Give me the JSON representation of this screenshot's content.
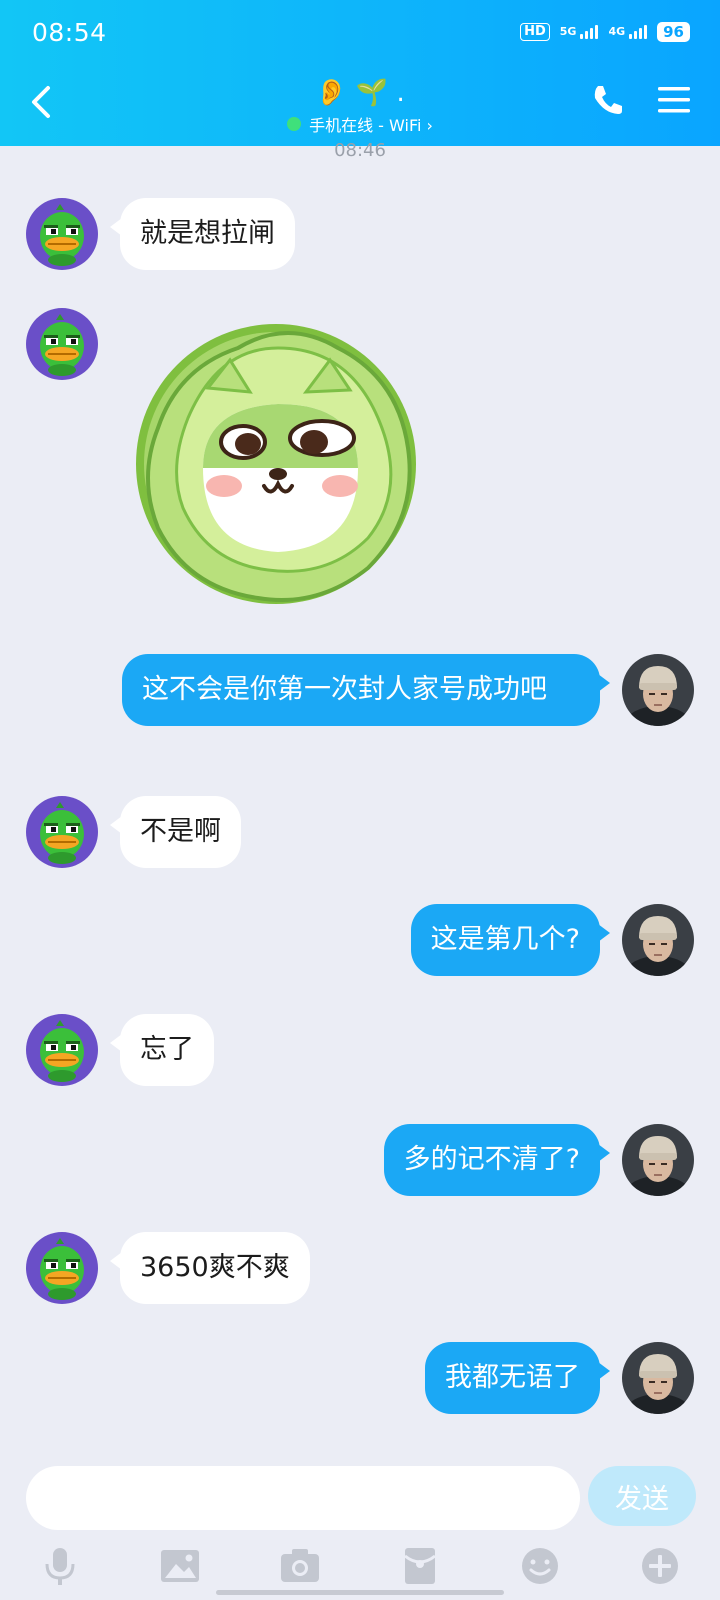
{
  "status_bar": {
    "time": "08:54",
    "hd_label": "HD",
    "network_1": "5G",
    "network_2": "4G",
    "battery": "96"
  },
  "header": {
    "title": "👂 🌱 .",
    "status": "手机在线 - WiFi ›"
  },
  "timestamp": "08:46",
  "messages": [
    {
      "side": "in",
      "text": "就是想拉闸"
    },
    {
      "side": "in",
      "type": "sticker"
    },
    {
      "side": "out",
      "text": "这不会是你第一次封人家号成功吧"
    },
    {
      "side": "in",
      "text": "不是啊"
    },
    {
      "side": "out",
      "text": "这是第几个?"
    },
    {
      "side": "in",
      "text": "忘了"
    },
    {
      "side": "out",
      "text": "多的记不清了?"
    },
    {
      "side": "in",
      "text": "3650爽不爽"
    },
    {
      "side": "out",
      "text": "我都无语了"
    }
  ],
  "input": {
    "placeholder": "",
    "send_label": "发送"
  },
  "toolbar": [
    "mic-icon",
    "image-icon",
    "camera-icon",
    "red-packet-icon",
    "emoji-icon",
    "plus-icon"
  ],
  "colors": {
    "header_start": "#12c6f6",
    "header_end": "#0aa5ff",
    "bubble_out": "#1ba8f5",
    "bubble_in": "#ffffff",
    "background": "#ebedf5"
  }
}
